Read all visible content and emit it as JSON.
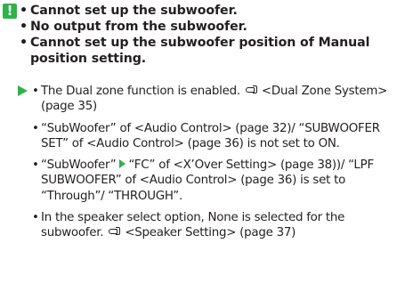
{
  "badge": {
    "symbol": "!",
    "color": "#2db34a"
  },
  "problems": {
    "bullet": "•",
    "items": [
      "Cannot set up the subwoofer.",
      "No output from the subwoofer.",
      "Cannot set up the subwoofer position of Manual position setting."
    ]
  },
  "causes": {
    "bullet": "•",
    "item1": {
      "text": "The Dual zone function is enabled.",
      "ref": "<Dual Zone System> (page 35)"
    },
    "item2": {
      "text": "“SubWoofer” of <Audio Control> (page 32)/ “SUBWOOFER SET” of <Audio Control> (page 36) is not set to ON."
    },
    "item3": {
      "part1": "“SubWoofer”",
      "part2": "“FC” of <X’Over Setting> (page 38))/ “LPF SUBWOOFER” of <Audio Control> (page 36) is set to “Through”/ “THROUGH”."
    },
    "item4": {
      "text": "In the speaker select option, None is selected for the subwoofer.",
      "ref": "<Speaker Setting> (page 37)"
    }
  },
  "icons": {
    "warning": "exclamation-badge-icon",
    "arrow": "green-arrow-right-icon",
    "reference": "pointing-hand-icon",
    "chevron": "green-chevron-right-icon"
  }
}
